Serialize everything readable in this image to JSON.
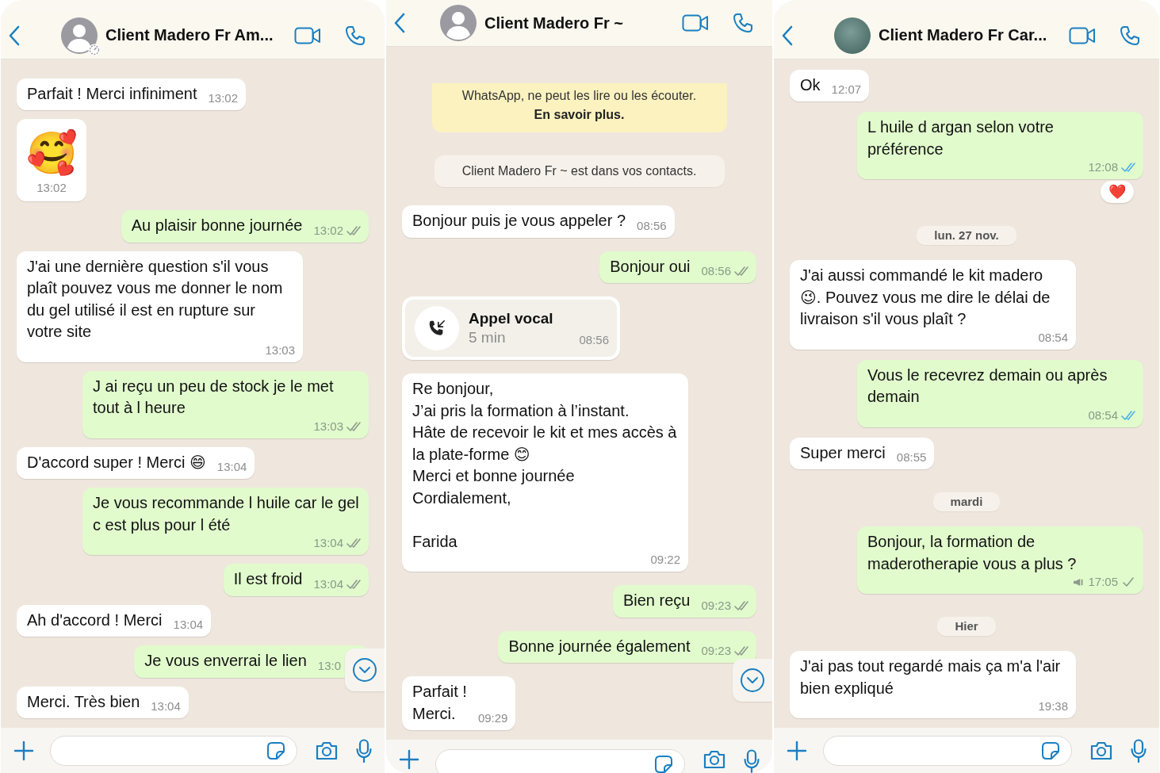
{
  "panels": [
    {
      "header": {
        "title": "Client Madero Fr Am...",
        "avatar": {
          "kind": "person",
          "status_badge": true
        }
      },
      "scroll_button": true,
      "messages": [
        {
          "kind": "in",
          "text": "Parfait ! Merci infiniment",
          "time": "13:02"
        },
        {
          "kind": "sticker",
          "emoji": "🥰",
          "time": "13:02"
        },
        {
          "kind": "out",
          "text": "Au plaisir bonne journée",
          "time": "13:02",
          "delivered": true,
          "read": false
        },
        {
          "kind": "in",
          "text": "J'ai une dernière question s'il vous plaît pouvez vous me donner le nom du gel utilisé il est en rupture sur votre site",
          "time": "13:03"
        },
        {
          "kind": "out",
          "text": "J ai reçu un peu de stock je le met tout à l heure",
          "time": "13:03",
          "delivered": true,
          "read": false
        },
        {
          "kind": "in",
          "text": "D'accord super ! Merci 😄",
          "time": "13:04"
        },
        {
          "kind": "out",
          "text": "Je vous recommande l huile car le gel c est plus pour l été",
          "time": "13:04",
          "delivered": true,
          "read": false
        },
        {
          "kind": "out",
          "text": "Il est froid",
          "time": "13:04",
          "delivered": true,
          "read": false
        },
        {
          "kind": "in",
          "text": "Ah d'accord ! Merci",
          "time": "13:04"
        },
        {
          "kind": "out",
          "text": "Je vous enverrai le lien",
          "time": "13:0"
        },
        {
          "kind": "in",
          "text": "Merci. Très bien",
          "time": "13:04"
        }
      ]
    },
    {
      "header": {
        "title": "Client Madero Fr ~",
        "avatar": {
          "kind": "person"
        }
      },
      "scroll_button": true,
      "messages": [
        {
          "kind": "notice",
          "text": "WhatsApp, ne peut les lire ou les écouter.",
          "link": "En savoir plus."
        },
        {
          "kind": "system",
          "text": "Client Madero Fr ~ est dans vos contacts."
        },
        {
          "kind": "in",
          "text": "Bonjour puis je vous appeler ?",
          "time": "08:56"
        },
        {
          "kind": "out",
          "text": "Bonjour oui",
          "time": "08:56",
          "delivered": true,
          "read": false
        },
        {
          "kind": "call",
          "title": "Appel vocal",
          "duration": "5 min",
          "time": "08:56"
        },
        {
          "kind": "in",
          "text": "Re bonjour,\nJ’ai pris la formation à l’instant.\nHâte de recevoir le kit et mes accès à la plate-forme 😊\nMerci et bonne journée\nCordialement,\n\nFarida",
          "time": "09:22"
        },
        {
          "kind": "out",
          "text": "Bien reçu",
          "time": "09:23",
          "delivered": true,
          "read": false
        },
        {
          "kind": "out",
          "text": "Bonne journée également",
          "time": "09:23",
          "delivered": true,
          "read": false
        },
        {
          "kind": "in",
          "text": "Parfait !\nMerci.",
          "time": "09:29"
        }
      ]
    },
    {
      "header": {
        "title": "Client Madero Fr Car...",
        "avatar": {
          "kind": "photo"
        }
      },
      "messages": [
        {
          "kind": "in",
          "text": "Ok",
          "time": "12:07"
        },
        {
          "kind": "out",
          "text": "L huile d argan selon votre préférence",
          "time": "12:08",
          "delivered": true,
          "read": true,
          "reaction": "❤️"
        },
        {
          "kind": "date",
          "text": "lun. 27 nov."
        },
        {
          "kind": "in",
          "text": "J'ai aussi commandé le kit madero 😉. Pouvez vous me dire le délai de livraison s'il vous plaît ?",
          "time": "08:54"
        },
        {
          "kind": "out",
          "text": "Vous le recevrez demain ou après demain",
          "time": "08:54",
          "delivered": true,
          "read": true
        },
        {
          "kind": "in",
          "text": "Super merci",
          "time": "08:55"
        },
        {
          "kind": "date",
          "text": "mardi"
        },
        {
          "kind": "out",
          "text": "Bonjour, la formation de maderotherapie vous a plus ?",
          "time": "17:05",
          "delivered": false,
          "read": false,
          "broadcast": true
        },
        {
          "kind": "date",
          "text": "Hier"
        },
        {
          "kind": "in",
          "text": "J'ai pas tout regardé mais ça m'a l'air bien expliqué",
          "time": "19:38"
        }
      ]
    }
  ]
}
